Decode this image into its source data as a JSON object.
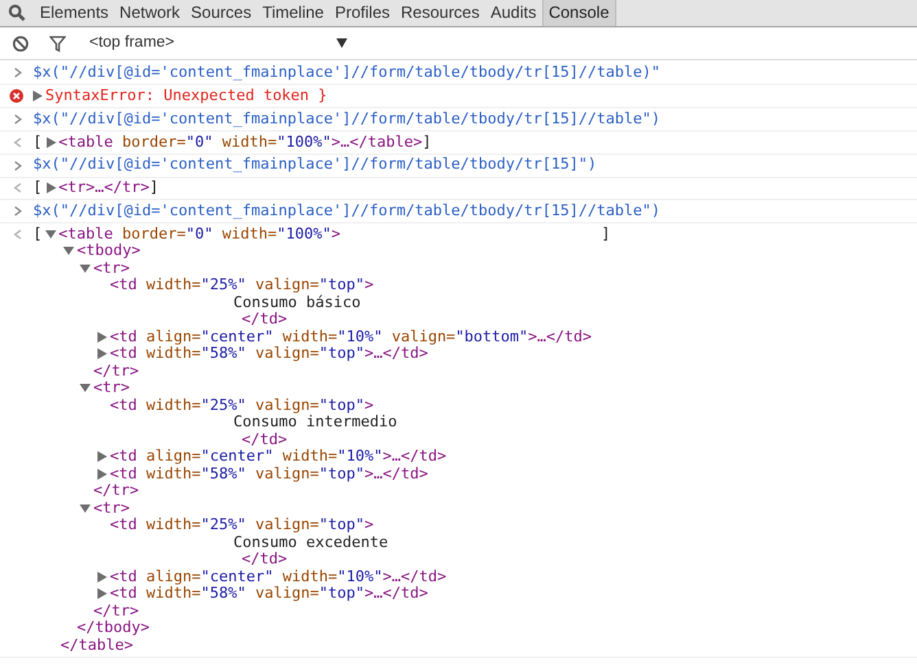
{
  "tabs": [
    {
      "label": "Elements",
      "selected": false
    },
    {
      "label": "Network",
      "selected": false
    },
    {
      "label": "Sources",
      "selected": false
    },
    {
      "label": "Timeline",
      "selected": false
    },
    {
      "label": "Profiles",
      "selected": false
    },
    {
      "label": "Resources",
      "selected": false
    },
    {
      "label": "Audits",
      "selected": false
    },
    {
      "label": "Console",
      "selected": true
    }
  ],
  "toolbar": {
    "context": "<top frame>"
  },
  "console": [
    {
      "kind": "input",
      "text": "$x(\"//div[@id='content_fmainplace']//form/table/tbody/tr[15]//table)\""
    },
    {
      "kind": "error",
      "text": "SyntaxError: Unexpected token }",
      "expanded": false
    },
    {
      "kind": "input",
      "text": "$x(\"//div[@id='content_fmainplace']//form/table/tbody/tr[15]//table\")"
    },
    {
      "kind": "output",
      "open": "[",
      "close": "]",
      "node": {
        "kind": "element",
        "expanded": false,
        "open": [
          {
            "kind": "tag",
            "text": "<table"
          },
          {
            "kind": "attr",
            "text": " border="
          },
          {
            "kind": "val",
            "text": "\"0\""
          },
          {
            "kind": "attr",
            "text": " width="
          },
          {
            "kind": "val",
            "text": "\"100%\""
          },
          {
            "kind": "tag",
            "text": ">…</table>"
          }
        ]
      }
    },
    {
      "kind": "input",
      "text": "$x(\"//div[@id='content_fmainplace']//form/table/tbody/tr[15]\")"
    },
    {
      "kind": "output",
      "open": "[",
      "close": "]",
      "node": {
        "kind": "element",
        "expanded": false,
        "open": [
          {
            "kind": "tag",
            "text": "<tr>…</tr>"
          }
        ]
      }
    },
    {
      "kind": "input",
      "text": "$x(\"//div[@id='content_fmainplace']//form/table/tbody/tr[15]//table\")"
    },
    {
      "kind": "output",
      "open": "[",
      "close": "]",
      "node": {
        "kind": "element",
        "expanded": true,
        "open": [
          {
            "kind": "tag",
            "text": "<table"
          },
          {
            "kind": "attr",
            "text": " border="
          },
          {
            "kind": "val",
            "text": "\"0\""
          },
          {
            "kind": "attr",
            "text": " width="
          },
          {
            "kind": "val",
            "text": "\"100%\""
          },
          {
            "kind": "tag",
            "text": ">"
          }
        ],
        "close": [
          {
            "kind": "tag",
            "text": "</table>"
          }
        ],
        "children": [
          {
            "kind": "element",
            "expanded": true,
            "open": [
              {
                "kind": "tag",
                "text": "<tbody>"
              }
            ],
            "close": [
              {
                "kind": "tag",
                "text": "</tbody>"
              }
            ],
            "children": [
              {
                "kind": "element",
                "expanded": true,
                "open": [
                  {
                    "kind": "tag",
                    "text": "<tr>"
                  }
                ],
                "close": [
                  {
                    "kind": "tag",
                    "text": "</tr>"
                  }
                ],
                "children": [
                  {
                    "kind": "inline",
                    "open": [
                      {
                        "kind": "tag",
                        "text": "<td"
                      },
                      {
                        "kind": "attr",
                        "text": " width="
                      },
                      {
                        "kind": "val",
                        "text": "\"25%\""
                      },
                      {
                        "kind": "attr",
                        "text": " valign="
                      },
                      {
                        "kind": "val",
                        "text": "\"top\""
                      },
                      {
                        "kind": "tag",
                        "text": ">"
                      }
                    ],
                    "text": "Consumo básico",
                    "close": [
                      {
                        "kind": "tag",
                        "text": "</td>"
                      }
                    ]
                  },
                  {
                    "kind": "element",
                    "expanded": false,
                    "open": [
                      {
                        "kind": "tag",
                        "text": "<td"
                      },
                      {
                        "kind": "attr",
                        "text": " align="
                      },
                      {
                        "kind": "val",
                        "text": "\"center\""
                      },
                      {
                        "kind": "attr",
                        "text": " width="
                      },
                      {
                        "kind": "val",
                        "text": "\"10%\""
                      },
                      {
                        "kind": "attr",
                        "text": " valign="
                      },
                      {
                        "kind": "val",
                        "text": "\"bottom\""
                      },
                      {
                        "kind": "tag",
                        "text": ">…</td>"
                      }
                    ]
                  },
                  {
                    "kind": "element",
                    "expanded": false,
                    "open": [
                      {
                        "kind": "tag",
                        "text": "<td"
                      },
                      {
                        "kind": "attr",
                        "text": " width="
                      },
                      {
                        "kind": "val",
                        "text": "\"58%\""
                      },
                      {
                        "kind": "attr",
                        "text": " valign="
                      },
                      {
                        "kind": "val",
                        "text": "\"top\""
                      },
                      {
                        "kind": "tag",
                        "text": ">…</td>"
                      }
                    ]
                  }
                ]
              },
              {
                "kind": "element",
                "expanded": true,
                "open": [
                  {
                    "kind": "tag",
                    "text": "<tr>"
                  }
                ],
                "close": [
                  {
                    "kind": "tag",
                    "text": "</tr>"
                  }
                ],
                "children": [
                  {
                    "kind": "inline",
                    "open": [
                      {
                        "kind": "tag",
                        "text": "<td"
                      },
                      {
                        "kind": "attr",
                        "text": " width="
                      },
                      {
                        "kind": "val",
                        "text": "\"25%\""
                      },
                      {
                        "kind": "attr",
                        "text": " valign="
                      },
                      {
                        "kind": "val",
                        "text": "\"top\""
                      },
                      {
                        "kind": "tag",
                        "text": ">"
                      }
                    ],
                    "text": "Consumo intermedio",
                    "close": [
                      {
                        "kind": "tag",
                        "text": "</td>"
                      }
                    ]
                  },
                  {
                    "kind": "element",
                    "expanded": false,
                    "open": [
                      {
                        "kind": "tag",
                        "text": "<td"
                      },
                      {
                        "kind": "attr",
                        "text": " align="
                      },
                      {
                        "kind": "val",
                        "text": "\"center\""
                      },
                      {
                        "kind": "attr",
                        "text": " width="
                      },
                      {
                        "kind": "val",
                        "text": "\"10%\""
                      },
                      {
                        "kind": "tag",
                        "text": ">…</td>"
                      }
                    ]
                  },
                  {
                    "kind": "element",
                    "expanded": false,
                    "open": [
                      {
                        "kind": "tag",
                        "text": "<td"
                      },
                      {
                        "kind": "attr",
                        "text": " width="
                      },
                      {
                        "kind": "val",
                        "text": "\"58%\""
                      },
                      {
                        "kind": "attr",
                        "text": " valign="
                      },
                      {
                        "kind": "val",
                        "text": "\"top\""
                      },
                      {
                        "kind": "tag",
                        "text": ">…</td>"
                      }
                    ]
                  }
                ]
              },
              {
                "kind": "element",
                "expanded": true,
                "open": [
                  {
                    "kind": "tag",
                    "text": "<tr>"
                  }
                ],
                "close": [
                  {
                    "kind": "tag",
                    "text": "</tr>"
                  }
                ],
                "children": [
                  {
                    "kind": "inline",
                    "open": [
                      {
                        "kind": "tag",
                        "text": "<td"
                      },
                      {
                        "kind": "attr",
                        "text": " width="
                      },
                      {
                        "kind": "val",
                        "text": "\"25%\""
                      },
                      {
                        "kind": "attr",
                        "text": " valign="
                      },
                      {
                        "kind": "val",
                        "text": "\"top\""
                      },
                      {
                        "kind": "tag",
                        "text": ">"
                      }
                    ],
                    "text": "Consumo excedente",
                    "close": [
                      {
                        "kind": "tag",
                        "text": "</td>"
                      }
                    ]
                  },
                  {
                    "kind": "element",
                    "expanded": false,
                    "open": [
                      {
                        "kind": "tag",
                        "text": "<td"
                      },
                      {
                        "kind": "attr",
                        "text": " align="
                      },
                      {
                        "kind": "val",
                        "text": "\"center\""
                      },
                      {
                        "kind": "attr",
                        "text": " width="
                      },
                      {
                        "kind": "val",
                        "text": "\"10%\""
                      },
                      {
                        "kind": "tag",
                        "text": ">…</td>"
                      }
                    ]
                  },
                  {
                    "kind": "element",
                    "expanded": false,
                    "open": [
                      {
                        "kind": "tag",
                        "text": "<td"
                      },
                      {
                        "kind": "attr",
                        "text": " width="
                      },
                      {
                        "kind": "val",
                        "text": "\"58%\""
                      },
                      {
                        "kind": "attr",
                        "text": " valign="
                      },
                      {
                        "kind": "val",
                        "text": "\"top\""
                      },
                      {
                        "kind": "tag",
                        "text": ">…</td>"
                      }
                    ]
                  }
                ]
              }
            ]
          }
        ]
      }
    }
  ]
}
